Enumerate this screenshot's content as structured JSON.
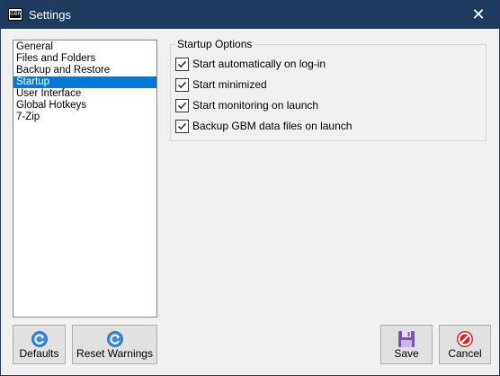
{
  "window": {
    "title": "Settings",
    "app_icon_text": "GBM",
    "close_glyph": "✕"
  },
  "nav": {
    "items": [
      {
        "label": "General",
        "selected": false
      },
      {
        "label": "Files and Folders",
        "selected": false
      },
      {
        "label": "Backup and Restore",
        "selected": false
      },
      {
        "label": "Startup",
        "selected": true
      },
      {
        "label": "User Interface",
        "selected": false
      },
      {
        "label": "Global Hotkeys",
        "selected": false
      },
      {
        "label": "7-Zip",
        "selected": false
      }
    ]
  },
  "startup_options": {
    "legend": "Startup Options",
    "options": [
      {
        "label": "Start automatically on log-in",
        "checked": true
      },
      {
        "label": "Start minimized",
        "checked": true
      },
      {
        "label": "Start monitoring on launch",
        "checked": true
      },
      {
        "label": "Backup GBM data files on launch",
        "checked": true
      }
    ]
  },
  "buttons": {
    "defaults": {
      "label": "Defaults",
      "icon": "refresh-icon"
    },
    "reset_warnings": {
      "label": "Reset Warnings",
      "icon": "refresh-icon"
    },
    "save": {
      "label": "Save",
      "icon": "floppy-disk-icon"
    },
    "cancel": {
      "label": "Cancel",
      "icon": "no-entry-icon"
    }
  },
  "colors": {
    "titlebar": "#1f3a5f",
    "selection": "#0078d7",
    "refresh_icon": "#3d8fd8",
    "save_icon": "#7e4fb8",
    "cancel_icon": "#d9262e"
  }
}
